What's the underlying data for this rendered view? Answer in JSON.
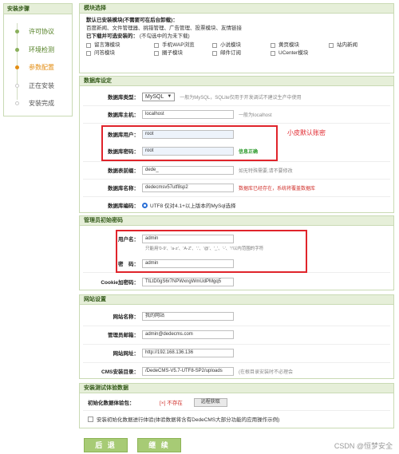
{
  "steps": {
    "title": "安装步骤",
    "items": [
      {
        "label": "许可协议",
        "state": "done"
      },
      {
        "label": "环境检测",
        "state": "done"
      },
      {
        "label": "参数配置",
        "state": "current"
      },
      {
        "label": "正在安装",
        "state": "todo"
      },
      {
        "label": "安装完成",
        "state": "todo"
      }
    ]
  },
  "modules": {
    "title": "模块选择",
    "installed_title": "默认已安装模块(不需要可在后台卸载)：",
    "installed_list": "百度新闻、文件管理器、挑错管理、广告管理、投票模块、友情链接",
    "optional_title": "已下载并可选安装的：",
    "optional_note": "(不勾选中的为未下载)",
    "options": [
      "留言簿模块",
      "手机WAP浏览",
      "小说模块",
      "黄页模块",
      "站内新闻",
      "问答模块",
      "圈子模块",
      "邮件订阅",
      "UCenter模块"
    ]
  },
  "db": {
    "title": "数据库设定",
    "type_label": "数据库类型：",
    "type_value": "MySQL",
    "type_tip": "一般为MySQL，SQLite仅用于开发调试不建议生产中使用",
    "host_label": "数据库主机：",
    "host_value": "localhost",
    "host_tip": "一般为localhost",
    "user_label": "数据库用户：",
    "user_value": "root",
    "pwd_label": "数据库密码：",
    "pwd_value": "root",
    "pwd_tip": "信息正确",
    "prefix_label": "数据表前缀：",
    "prefix_value": "dede_",
    "prefix_tip": "如无特殊需要,请不要修改",
    "name_label": "数据库名称：",
    "name_value": "dedecmsv57utf8sp2",
    "name_tip": "数据库已经存在，系统将覆盖数据库",
    "charset_label": "数据库编码：",
    "charset_value": "UTF8 仅对4.1+以上版本的MySql选择",
    "annotation": "小皮默认账密"
  },
  "admin": {
    "title": "管理员初始密码",
    "user_label": "用户名：",
    "user_value": "admin",
    "user_tip": "只能用'0-9'、'a-z'、'A-Z'、'.'、'@'、'_'、'-'、'!'以内范围的字符",
    "pwd_label": "密　码：",
    "pwd_value": "admin",
    "cookie_label": "Cookie加密码：",
    "cookie_value": "TtLtD0gS6r7NPWxngWmUdPMgq5"
  },
  "site": {
    "title": "网站设置",
    "name_label": "网站名称：",
    "name_value": "我的网站",
    "email_label": "管理员邮箱：",
    "email_value": "admin@dedecms.com",
    "url_label": "网站网址：",
    "url_value": "http://192.168.136.136",
    "dir_label": "CMS安装目录：",
    "dir_value": "/DedeCMS-V5.7-UTF8-SP2/uploads",
    "dir_tip": "(在根目录安装时不必理会"
  },
  "demo": {
    "title": "安装测试体验数据",
    "pkg_label": "初始化数据体验包：",
    "pkg_status": "[×] 不存在",
    "pkg_button": "远程获取",
    "install_label": "安装初始化数据进行体验(体验数据将含有DedeCMS大部分功能的应用操作示例)"
  },
  "footer": {
    "back_button": "后 退",
    "next_button": "继 续",
    "watermark": "CSDN @恒梦安全"
  },
  "colors": {
    "accent_green": "#a7cb75",
    "annotation_red": "#e0242b",
    "current_step": "#e38d13"
  }
}
